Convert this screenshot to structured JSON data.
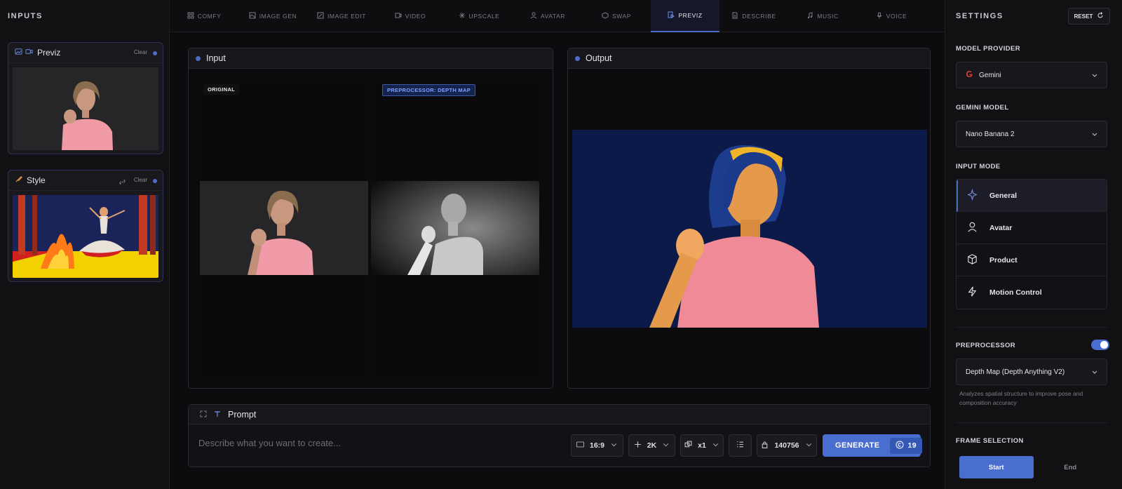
{
  "inputs_panel": {
    "title": "INPUTS",
    "cards": [
      {
        "title": "Previz",
        "clear": "Clear"
      },
      {
        "title": "Style",
        "clear": "Clear"
      }
    ]
  },
  "tabs": [
    {
      "label": "COMFY",
      "icon": "grid-icon"
    },
    {
      "label": "IMAGE GEN",
      "icon": "image-icon"
    },
    {
      "label": "IMAGE EDIT",
      "icon": "edit-icon"
    },
    {
      "label": "VIDEO",
      "icon": "video-icon"
    },
    {
      "label": "UPSCALE",
      "icon": "sparkle-icon"
    },
    {
      "label": "AVATAR",
      "icon": "person-icon"
    },
    {
      "label": "SWAP",
      "icon": "swap-icon"
    },
    {
      "label": "PREVIZ",
      "icon": "previz-icon",
      "active": true
    },
    {
      "label": "DESCRIBE",
      "icon": "document-icon"
    },
    {
      "label": "MUSIC",
      "icon": "music-icon"
    },
    {
      "label": "VOICE",
      "icon": "mic-icon"
    }
  ],
  "input_panel": {
    "title": "Input",
    "original_label": "ORIGINAL",
    "preprocessor_label": "PREPROCESSOR: DEPTH MAP"
  },
  "output_panel": {
    "title": "Output"
  },
  "prompt": {
    "title": "Prompt",
    "placeholder": "Describe what you want to create...",
    "aspect_ratio": "16:9",
    "resolution": "2K",
    "count": "x1",
    "seed": "140756",
    "generate_label": "GENERATE",
    "credits": "19"
  },
  "settings": {
    "title": "SETTINGS",
    "reset_label": "RESET",
    "model_provider_label": "MODEL PROVIDER",
    "model_provider": "Gemini",
    "gemini_model_label": "GEMINI MODEL",
    "gemini_model": "Nano Banana 2",
    "input_mode_label": "INPUT MODE",
    "input_modes": [
      {
        "label": "General",
        "icon": "sparkles-icon",
        "active": true
      },
      {
        "label": "Avatar",
        "icon": "user-icon"
      },
      {
        "label": "Product",
        "icon": "cube-icon"
      },
      {
        "label": "Motion Control",
        "icon": "bolt-icon"
      }
    ],
    "preprocessor_label": "PREPROCESSOR",
    "preprocessor_enabled": true,
    "preprocessor_value": "Depth Map (Depth Anything V2)",
    "preprocessor_help": "Analyzes spatial structure to improve pose and composition accuracy",
    "frame_selection_label": "FRAME SELECTION",
    "frame_start": "Start",
    "frame_end": "End"
  },
  "colors": {
    "accent": "#4e6bc7",
    "button": "#4a6dd0",
    "background": "#0c0c0e"
  }
}
